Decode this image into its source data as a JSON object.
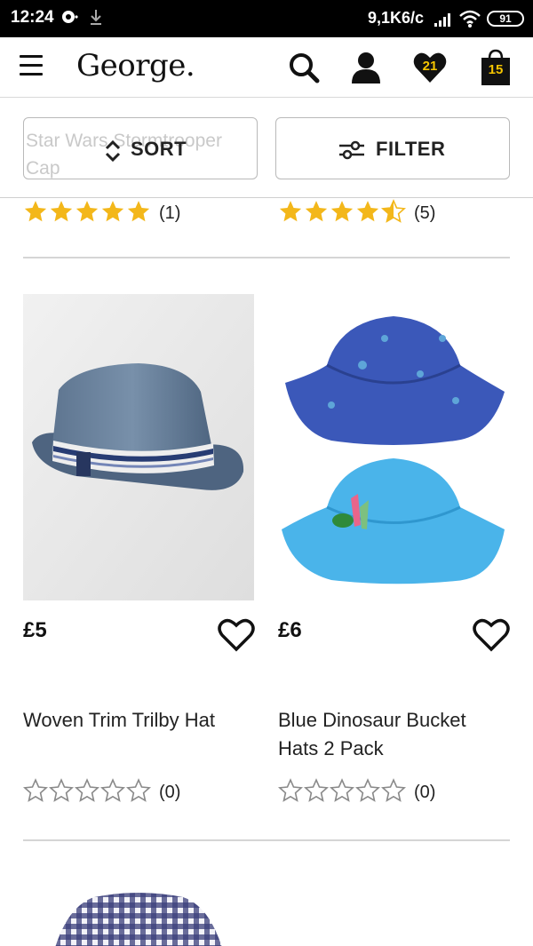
{
  "status_bar": {
    "time": "12:24",
    "network_speed": "9,1K6/c",
    "battery_level": "91",
    "icons": [
      "chat-bubble-icon",
      "download-icon",
      "signal-icon",
      "wifi-icon",
      "battery-icon"
    ]
  },
  "header": {
    "logo_text": "George.",
    "wishlist_count": "21",
    "basket_count": "15",
    "icons": [
      "menu-icon",
      "search-icon",
      "account-icon",
      "heart-icon",
      "shopping-bag-icon"
    ],
    "accent_color": "#f4c400"
  },
  "controls": {
    "ghost_title": "Star Wars Stormtrooper Cap",
    "sort_label": "SORT",
    "filter_label": "FILTER"
  },
  "previous_ratings": [
    {
      "rating": 5,
      "count_label": "(1)"
    },
    {
      "rating": 4.5,
      "count_label": "(5)"
    }
  ],
  "products": [
    {
      "price": "£5",
      "title": "Woven Trim Trilby Hat",
      "rating": 0,
      "count_label": "(0)",
      "image": "grey-blue-trilby-hat-photo"
    },
    {
      "price": "£6",
      "title": "Blue Dinosaur Bucket Hats 2 Pack",
      "rating": 0,
      "count_label": "(0)",
      "image": "blue-bucket-hats-photo"
    }
  ],
  "next_product": {
    "image": "gingham-hat-photo"
  },
  "colors": {
    "star_filled": "#f3b71a",
    "star_empty": "#8a8a8a",
    "text": "#111111"
  }
}
